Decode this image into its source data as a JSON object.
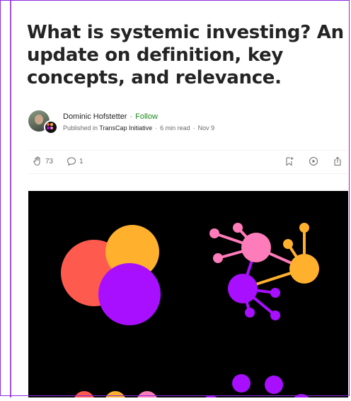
{
  "article": {
    "title": "What is systemic investing? An update on definition, key concepts, and relevance."
  },
  "byline": {
    "author": "Dominic Hofstetter",
    "separator": "·",
    "follow": "Follow",
    "published_in_prefix": "Published in",
    "publication": "TransCap Initiative",
    "read_time": "6 min read",
    "date": "Nov 9"
  },
  "actions": {
    "claps": "73",
    "responses": "1"
  },
  "colors": {
    "accent_green": "#1a8917",
    "coral": "#ff5a4e",
    "orange": "#ffb12e",
    "purple": "#a80fff",
    "pink": "#ff7cba"
  }
}
